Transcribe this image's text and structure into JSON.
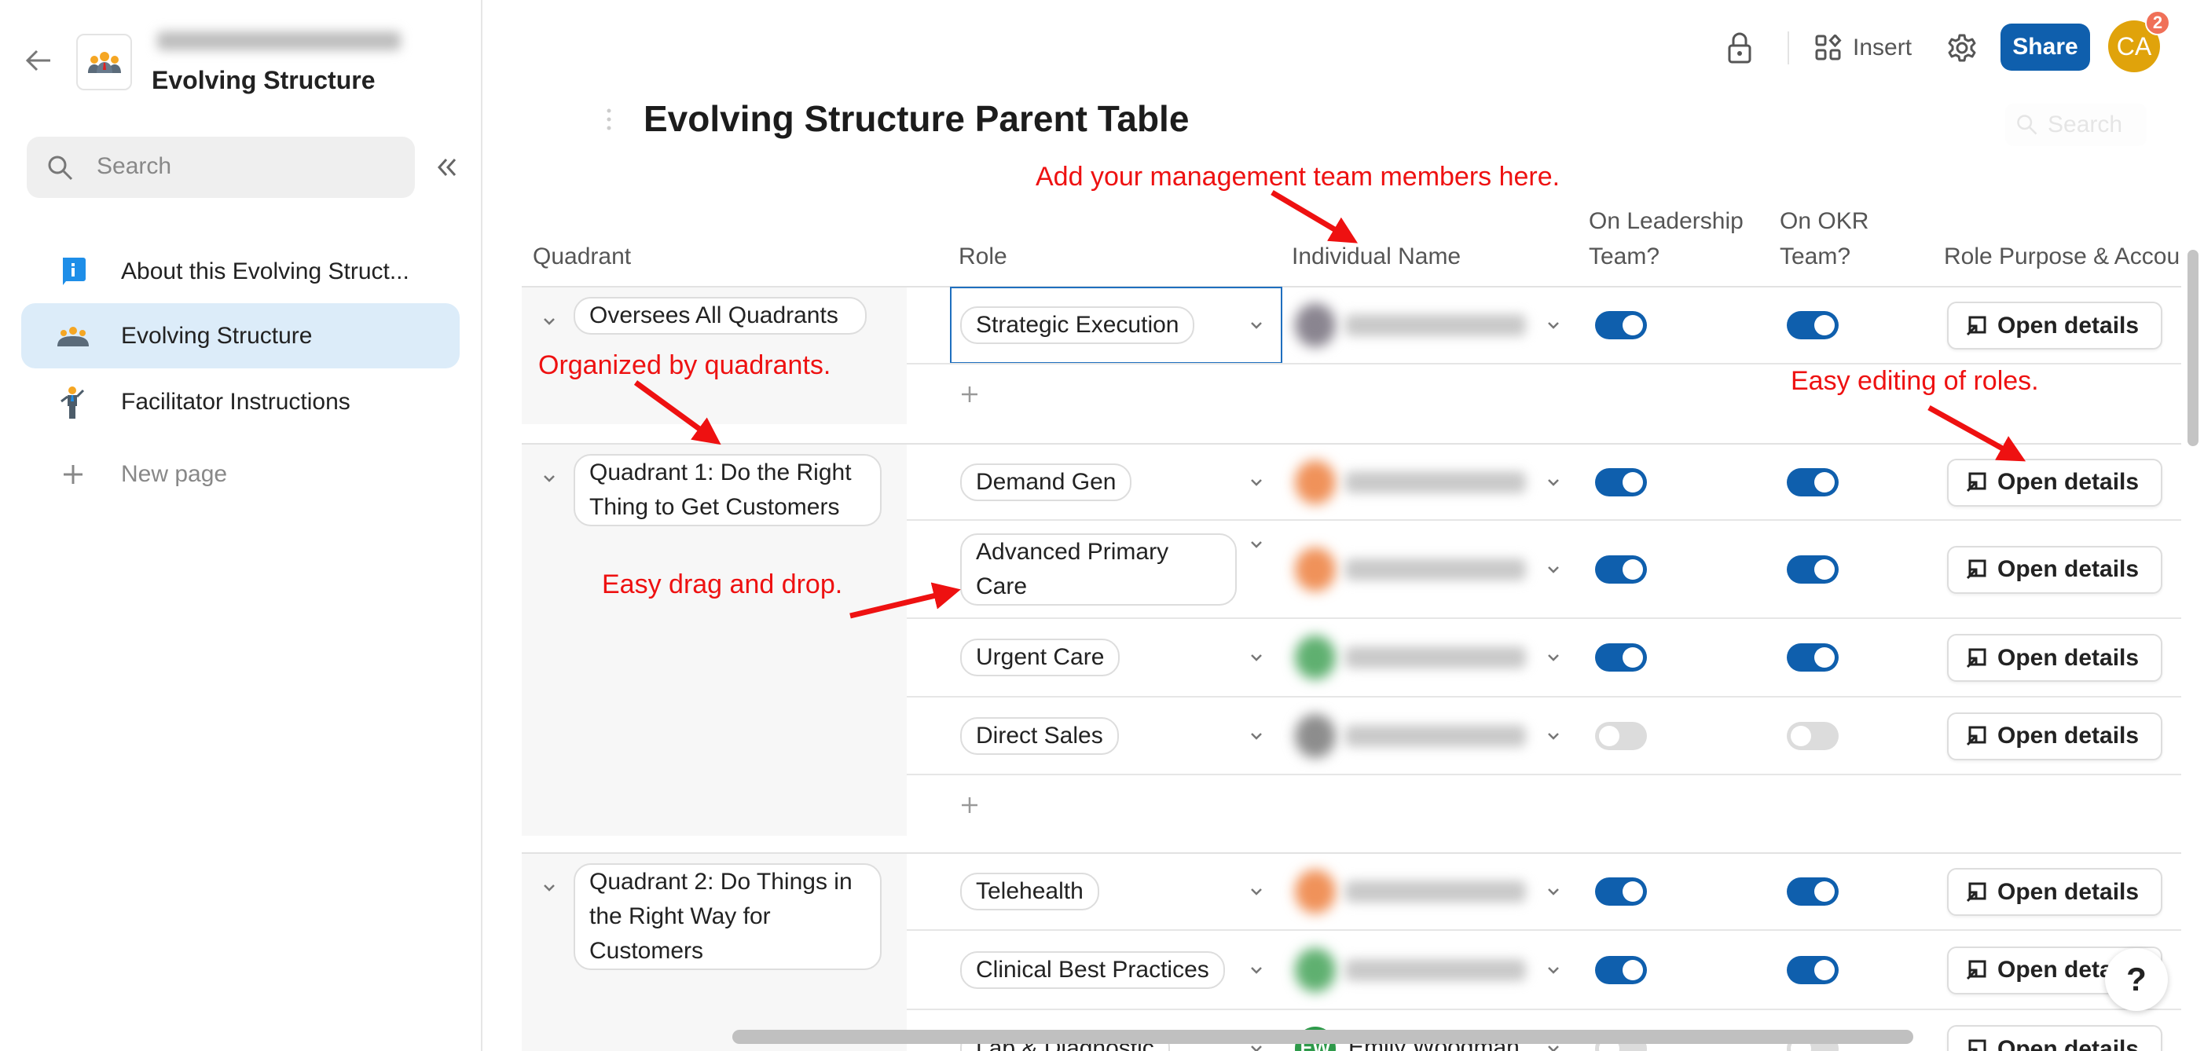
{
  "sidebar": {
    "doc_title": "Evolving Structure",
    "search_placeholder": "Search",
    "items": [
      {
        "label": "About this Evolving Struct...",
        "icon": "info-icon",
        "active": false
      },
      {
        "label": "Evolving Structure",
        "icon": "team-icon",
        "active": true
      },
      {
        "label": "Facilitator Instructions",
        "icon": "facilitator-icon",
        "active": false
      }
    ],
    "new_page_label": "New page"
  },
  "toolbar": {
    "insert_label": "Insert",
    "share_label": "Share",
    "avatar_initials": "CA",
    "notification_count": "2",
    "share_color": "#0f5fad",
    "avatar_color": "#e0a30b"
  },
  "main": {
    "table_title": "Evolving Structure Parent Table",
    "search_placeholder": "Search",
    "columns": [
      "Quadrant",
      "Role",
      "Individual Name",
      "On Leadership Team?",
      "On OKR Team?",
      "Role Purpose & Accou"
    ],
    "open_details_label": "Open details",
    "toggle_on_color": "#0f5fad",
    "groups": [
      {
        "quadrant": "Oversees All Quadrants",
        "rows": [
          {
            "role": "Strategic Execution",
            "name": "",
            "avatar_color": "#8a8590",
            "leadership": true,
            "okr": true
          }
        ]
      },
      {
        "quadrant": "Quadrant 1: Do the Right Thing to Get Customers",
        "rows": [
          {
            "role": "Demand Gen",
            "name": "",
            "avatar_color": "#f0925a",
            "leadership": true,
            "okr": true
          },
          {
            "role": "Advanced Primary Care",
            "name": "",
            "avatar_color": "#f0925a",
            "leadership": true,
            "okr": true
          },
          {
            "role": "Urgent Care",
            "name": "",
            "avatar_color": "#5fb070",
            "leadership": true,
            "okr": true
          },
          {
            "role": "Direct Sales",
            "name": "",
            "avatar_color": "#8d8d8d",
            "leadership": false,
            "okr": false
          }
        ]
      },
      {
        "quadrant": "Quadrant 2: Do Things in the Right Way for Customers",
        "rows": [
          {
            "role": "Telehealth",
            "name": "",
            "avatar_color": "#f0925a",
            "leadership": true,
            "okr": true
          },
          {
            "role": "Clinical Best Practices",
            "name": "",
            "avatar_color": "#5fb070",
            "leadership": true,
            "okr": true
          },
          {
            "role": "Lab & Diagnostic",
            "name": "Emily Woodman",
            "avatar_initials": "EW",
            "avatar_color": "#2e9a4a",
            "leadership": false,
            "okr": false
          }
        ]
      }
    ]
  },
  "annotations": [
    "Add your management team members here.",
    "Organized by quadrants.",
    "Easy editing of roles.",
    "Easy drag and drop."
  ],
  "help_label": "?"
}
